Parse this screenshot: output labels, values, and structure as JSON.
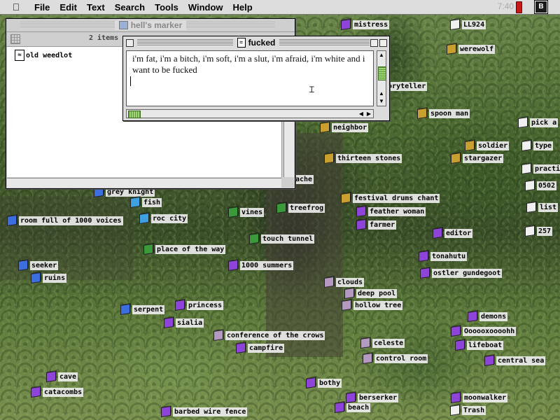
{
  "menubar": {
    "apple": "",
    "items": [
      "File",
      "Edit",
      "Text",
      "Search",
      "Tools",
      "Window",
      "Help"
    ],
    "clock": "7:40"
  },
  "finder_window": {
    "title": "hell's marker",
    "item_count": "2 items",
    "files": [
      "old weedlot"
    ]
  },
  "editor_window": {
    "title": "fucked",
    "text": "i'm fat, i'm a bitch, i'm soft, i'm a slut, i'm afraid, i'm white and i want to be fucked"
  },
  "desktop_icons": [
    {
      "label": "mistress",
      "color": "purple"
    },
    {
      "label": "LL924",
      "color": "generic"
    },
    {
      "label": "werewolf",
      "color": "gold"
    },
    {
      "label": "storyteller",
      "color": "none"
    },
    {
      "label": "spoon man",
      "color": "gold"
    },
    {
      "label": "pick a",
      "color": "generic"
    },
    {
      "label": "neighbor",
      "color": "gold"
    },
    {
      "label": "soldier",
      "color": "gold"
    },
    {
      "label": "type",
      "color": "generic"
    },
    {
      "label": "thirteen stones",
      "color": "gold"
    },
    {
      "label": "stargazer",
      "color": "gold"
    },
    {
      "label": "practi",
      "color": "generic"
    },
    {
      "label": "ache",
      "color": "none"
    },
    {
      "label": "0502",
      "color": "generic"
    },
    {
      "label": "grey knight",
      "color": "blue"
    },
    {
      "label": "festival drums chant",
      "color": "gold"
    },
    {
      "label": "list",
      "color": "generic"
    },
    {
      "label": "fish",
      "color": "blue2"
    },
    {
      "label": "treefrog",
      "color": "green"
    },
    {
      "label": "vines",
      "color": "green"
    },
    {
      "label": "feather woman",
      "color": "purple"
    },
    {
      "label": "room full of 1000 voices",
      "color": "blue"
    },
    {
      "label": "roc city",
      "color": "blue2"
    },
    {
      "label": "farmer",
      "color": "purple"
    },
    {
      "label": "editor",
      "color": "purple"
    },
    {
      "label": "257",
      "color": "generic"
    },
    {
      "label": "touch tunnel",
      "color": "green"
    },
    {
      "label": "place of the way",
      "color": "green"
    },
    {
      "label": "tonahutu",
      "color": "purple"
    },
    {
      "label": "seeker",
      "color": "blue"
    },
    {
      "label": "1000 summers",
      "color": "purple"
    },
    {
      "label": "ostler gundegoot",
      "color": "purple"
    },
    {
      "label": "ruins",
      "color": "blue"
    },
    {
      "label": "clouds",
      "color": "lilac"
    },
    {
      "label": "deep pool",
      "color": "lilac"
    },
    {
      "label": "hollow tree",
      "color": "lilac"
    },
    {
      "label": "serpent",
      "color": "blue"
    },
    {
      "label": "princess",
      "color": "purple"
    },
    {
      "label": "demons",
      "color": "purple"
    },
    {
      "label": "sialia",
      "color": "purple"
    },
    {
      "label": "Oooooxoooohh",
      "color": "purple"
    },
    {
      "label": "conference of the crows",
      "color": "lilac"
    },
    {
      "label": "celeste",
      "color": "lilac"
    },
    {
      "label": "lifeboat",
      "color": "purple"
    },
    {
      "label": "campfire",
      "color": "purple"
    },
    {
      "label": "control room",
      "color": "lilac"
    },
    {
      "label": "central sea",
      "color": "purple"
    },
    {
      "label": "cave",
      "color": "purple"
    },
    {
      "label": "bothy",
      "color": "purple"
    },
    {
      "label": "catacombs",
      "color": "purple"
    },
    {
      "label": "berserker",
      "color": "purple"
    },
    {
      "label": "moonwalker",
      "color": "purple"
    },
    {
      "label": "beach",
      "color": "purple"
    },
    {
      "label": "barbed wire fence",
      "color": "purple"
    },
    {
      "label": "Trash",
      "color": "generic"
    }
  ],
  "colors": {
    "purple": "#8e44d8",
    "blue": "#3b6fe0",
    "blue2": "#3ea0e0",
    "green": "#3a9a3a",
    "gold": "#c9a030",
    "lilac": "#b49ac0",
    "menubar": "#dddddd",
    "battery": "#c81818"
  },
  "icons": {
    "apple": "apple-menu-icon",
    "battery": "battery-icon",
    "app": "application-switcher-icon",
    "doc": "text-document-icon",
    "trash": "trash-can-icon"
  }
}
